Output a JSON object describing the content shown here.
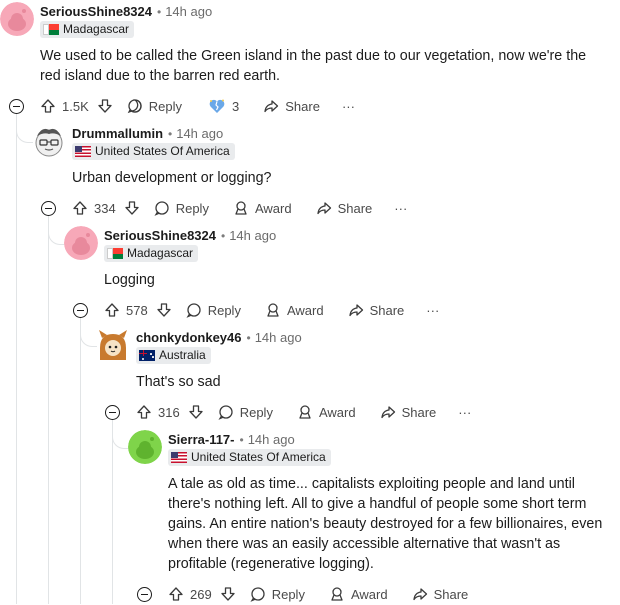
{
  "comments": [
    {
      "author": "SeriousShine8324",
      "time": "14h ago",
      "flair": "Madagascar",
      "body": "We used to be called the Green island in the past due to our vegetation, now we're the red island due to the barren red earth.",
      "votes": "1.5K",
      "reply_label": "Reply",
      "award_count": "3",
      "share_label": "Share",
      "more_label": "···"
    },
    {
      "author": "Drummallumin",
      "time": "14h ago",
      "flair": "United States Of America",
      "body": "Urban development or logging?",
      "votes": "334",
      "reply_label": "Reply",
      "award_label": "Award",
      "share_label": "Share",
      "more_label": "···"
    },
    {
      "author": "SeriousShine8324",
      "time": "14h ago",
      "flair": "Madagascar",
      "body": "Logging",
      "votes": "578",
      "reply_label": "Reply",
      "award_label": "Award",
      "share_label": "Share",
      "more_label": "···"
    },
    {
      "author": "chonkydonkey46",
      "time": "14h ago",
      "flair": "Australia",
      "body": "That's so sad",
      "votes": "316",
      "reply_label": "Reply",
      "award_label": "Award",
      "share_label": "Share",
      "more_label": "···"
    },
    {
      "author": "Sierra-117-",
      "time": "14h ago",
      "flair": "United States Of America",
      "body": "A tale as old as time... capitalists exploiting people and land until there's nothing left. All to give a handful of people some short term gains. An entire nation's beauty destroyed for a few billionaires, even when there was an easily accessible alternative that wasn't as profitable (regenerative logging).",
      "votes": "269",
      "reply_label": "Reply",
      "award_label": "Award",
      "share_label": "Share",
      "more_label": "···"
    }
  ],
  "colors": {
    "avatar_pink": "#f7a8b8",
    "avatar_green": "#7fd44a",
    "flair_bg": "#e9ebed",
    "thread_line": "#e1e4e6"
  },
  "icons": [
    "upvote-icon",
    "downvote-icon",
    "reply-icon",
    "award-icon",
    "share-icon",
    "heart-award-icon",
    "collapse-icon"
  ]
}
